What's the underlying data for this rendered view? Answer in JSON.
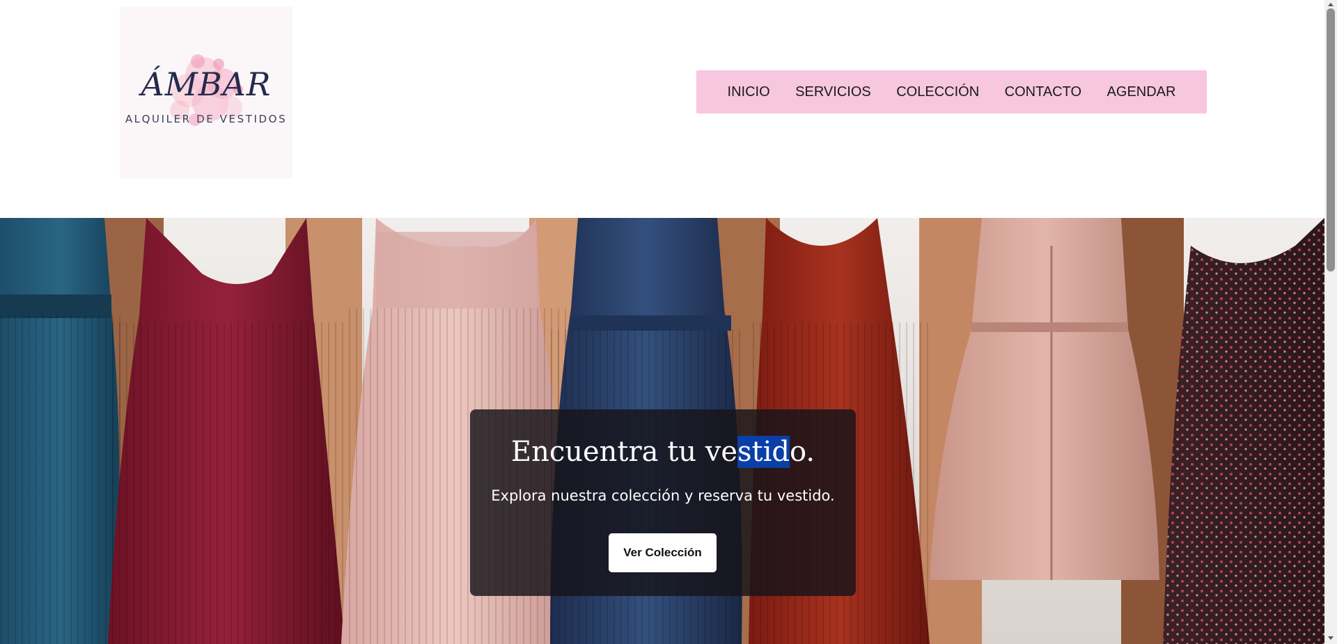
{
  "brand": {
    "title": "ÁMBAR",
    "subtitle": "ALQUILER DE VESTIDOS"
  },
  "nav": {
    "items": [
      {
        "label": "INICIO",
        "name": "nav-item-inicio"
      },
      {
        "label": "SERVICIOS",
        "name": "nav-item-servicios"
      },
      {
        "label": "COLECCIÓN",
        "name": "nav-item-coleccion"
      },
      {
        "label": "CONTACTO",
        "name": "nav-item-contacto"
      },
      {
        "label": "AGENDAR",
        "name": "nav-item-agendar"
      }
    ]
  },
  "hero": {
    "headline_before": "Encuentra tu ve",
    "headline_selected": "stid",
    "headline_after": "o.",
    "subheading": "Explora nuestra colección y reserva tu vestido.",
    "button_label": "Ver Colección"
  },
  "colors": {
    "nav_background": "#f7c6df",
    "overlay": "#16141a",
    "selection": "#0b3fa8"
  }
}
